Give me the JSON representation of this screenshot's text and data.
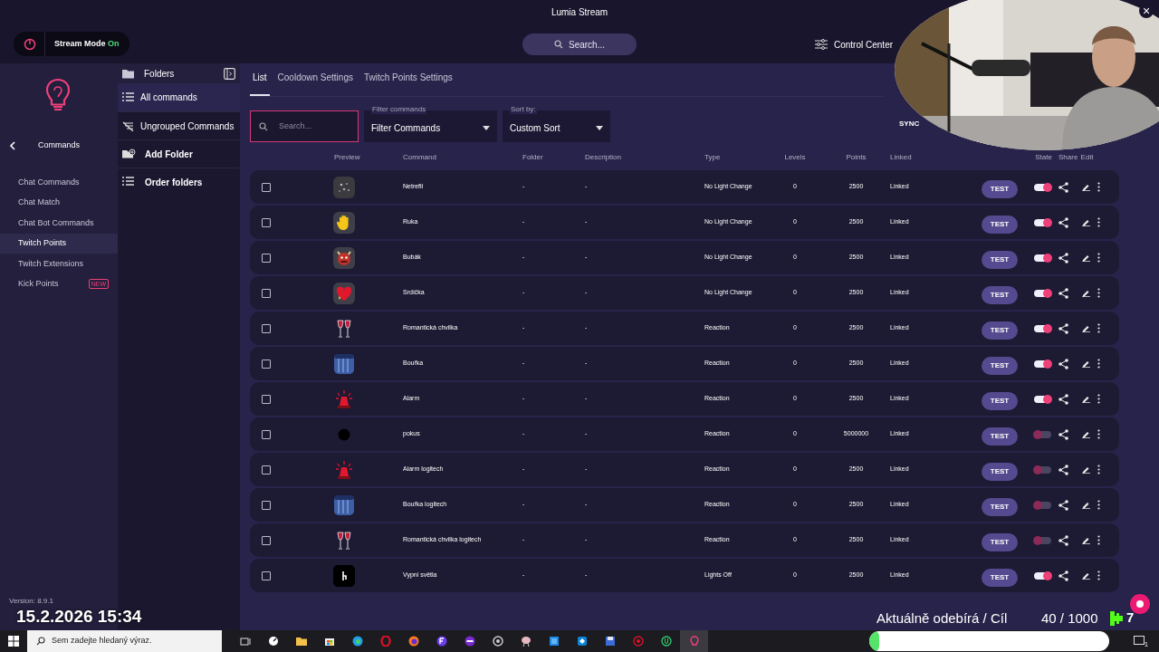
{
  "window": {
    "title": "Lumia Stream",
    "close": "×"
  },
  "top_bar": {
    "stream_mode": {
      "label": "Stream Mode",
      "state": "On",
      "on": true
    },
    "search": {
      "placeholder": "Search..."
    },
    "control_center": "Control Center"
  },
  "sidebar": {
    "section": "Commands",
    "items": [
      {
        "label": "Chat Commands",
        "selected": false
      },
      {
        "label": "Chat Match",
        "selected": false
      },
      {
        "label": "Chat Bot Commands",
        "selected": false
      },
      {
        "label": "Twitch Points",
        "selected": true
      },
      {
        "label": "Twitch Extensions",
        "selected": false
      },
      {
        "label": "Kick Points",
        "selected": false,
        "badge": "NEW"
      }
    ],
    "version": "Version: 8.9.1"
  },
  "folders": {
    "title": "Folders",
    "items": [
      {
        "label": "All commands",
        "kind": "list",
        "selected": true
      },
      {
        "label": "Ungrouped Commands",
        "kind": "ungrouped",
        "selected": false
      }
    ],
    "actions": [
      {
        "label": "Add Folder",
        "kind": "add"
      },
      {
        "label": "Order folders",
        "kind": "order"
      }
    ]
  },
  "tabs": [
    {
      "label": "List",
      "selected": true
    },
    {
      "label": "Cooldown Settings",
      "selected": false
    },
    {
      "label": "Twitch Points Settings",
      "selected": false
    }
  ],
  "filters": {
    "search": {
      "placeholder": "Search..."
    },
    "filter": {
      "label": "Filter commands",
      "value": "Filter Commands"
    },
    "sort": {
      "label": "Sort by:",
      "value": "Custom Sort"
    },
    "sync": "SYNC"
  },
  "table": {
    "columns": [
      "Preview",
      "Command",
      "Folder",
      "Description",
      "Type",
      "Levels",
      "Points",
      "Linked",
      "State",
      "Share",
      "Edit"
    ],
    "rows": [
      {
        "checked": false,
        "preview": {
          "kind": "sparkles"
        },
        "command": "Netrefil",
        "folder": "-",
        "description": "-",
        "type": "No Light Change",
        "levels": "0",
        "points": "2500",
        "linked": "Linked",
        "test": "TEST",
        "on": true
      },
      {
        "checked": false,
        "preview": {
          "kind": "hand"
        },
        "command": "Ruka",
        "folder": "-",
        "description": "-",
        "type": "No Light Change",
        "levels": "0",
        "points": "2500",
        "linked": "Linked",
        "test": "TEST",
        "on": true
      },
      {
        "checked": false,
        "preview": {
          "kind": "devil"
        },
        "command": "Bubák",
        "folder": "-",
        "description": "-",
        "type": "No Light Change",
        "levels": "0",
        "points": "2500",
        "linked": "Linked",
        "test": "TEST",
        "on": true
      },
      {
        "checked": false,
        "preview": {
          "kind": "heart"
        },
        "command": "Srdíčka",
        "folder": "-",
        "description": "-",
        "type": "No Light Change",
        "levels": "0",
        "points": "2500",
        "linked": "Linked",
        "test": "TEST",
        "on": true
      },
      {
        "checked": false,
        "preview": {
          "kind": "wine"
        },
        "command": "Romantická chvilka",
        "folder": "-",
        "description": "-",
        "type": "Reaction",
        "levels": "0",
        "points": "2500",
        "linked": "Linked",
        "test": "TEST",
        "on": true
      },
      {
        "checked": false,
        "preview": {
          "kind": "storm"
        },
        "command": "Bouřka",
        "folder": "-",
        "description": "-",
        "type": "Reaction",
        "levels": "0",
        "points": "2500",
        "linked": "Linked",
        "test": "TEST",
        "on": true
      },
      {
        "checked": false,
        "preview": {
          "kind": "siren"
        },
        "command": "Alarm",
        "folder": "-",
        "description": "-",
        "type": "Reaction",
        "levels": "0",
        "points": "2500",
        "linked": "Linked",
        "test": "TEST",
        "on": true
      },
      {
        "checked": false,
        "preview": {
          "kind": "dot"
        },
        "command": "pokus",
        "folder": "-",
        "description": "-",
        "type": "Reaction",
        "levels": "0",
        "points": "5000000",
        "linked": "Linked",
        "test": "TEST",
        "on": false
      },
      {
        "checked": false,
        "preview": {
          "kind": "siren"
        },
        "command": "Alarm logitech",
        "folder": "-",
        "description": "-",
        "type": "Reaction",
        "levels": "0",
        "points": "2500",
        "linked": "Linked",
        "test": "TEST",
        "on": false
      },
      {
        "checked": false,
        "preview": {
          "kind": "storm"
        },
        "command": "Bouřka logitech",
        "folder": "-",
        "description": "-",
        "type": "Reaction",
        "levels": "0",
        "points": "2500",
        "linked": "Linked",
        "test": "TEST",
        "on": false
      },
      {
        "checked": false,
        "preview": {
          "kind": "wine"
        },
        "command": "Romantická chvilka logitech",
        "folder": "-",
        "description": "-",
        "type": "Reaction",
        "levels": "0",
        "points": "2500",
        "linked": "Linked",
        "test": "TEST",
        "on": false
      },
      {
        "checked": false,
        "preview": {
          "kind": "switch"
        },
        "command": "Vypni světla",
        "folder": "-",
        "description": "-",
        "type": "Lights Off",
        "levels": "0",
        "points": "2500",
        "linked": "Linked",
        "test": "TEST",
        "on": true
      }
    ]
  },
  "stream_overlay": {
    "date_time": "15.2.2026 15:34",
    "goal_label": "Aktuálně odebírá / Cíl",
    "goal_value": "40 / 1000",
    "kick_count": "7",
    "goal_bar": {
      "level": 0.04
    }
  },
  "taskbar": {
    "search": {
      "placeholder": "Sem zadejte hledaný výraz."
    },
    "notification_count": "1"
  }
}
